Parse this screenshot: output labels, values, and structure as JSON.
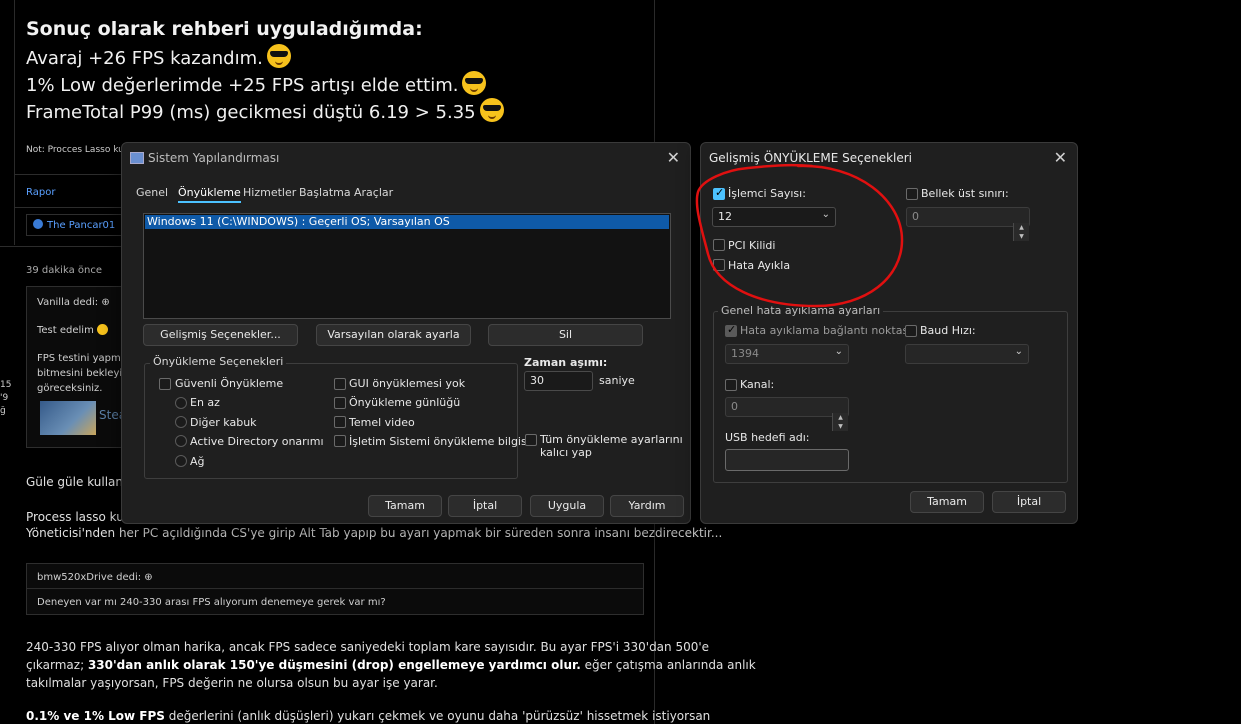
{
  "forum": {
    "heading": "Sonuç olarak rehberi uyguladığımda:",
    "lines": [
      "Avaraj +26 FPS kazandım.",
      "1% Low değerlerimde +25 FPS artışı elde ettim.",
      "FrameTotal P99 (ms) gecikmesi düştü 6.19 > 5.35"
    ],
    "note": "Not: Procces Lasso kull",
    "report_link": "Rapor",
    "reaction_user": "The Pancar01",
    "post_time": "39 dakika önce",
    "quote1_author": "Vanilla dedi:",
    "quote1_text": "Test edelim",
    "quote1_body1": "FPS testini yapmak",
    "quote1_body2": "bitmesini bekleyin.",
    "quote1_body3": "göreceksiniz.",
    "steam_label": "Stea",
    "side_nums": [
      "15",
      "'9",
      "ğ"
    ],
    "reply1": "Güle güle kullanın",
    "reply2": "Process lasso kulla",
    "reply3": "Yöneticisi'nden her PC açıldığında CS'ye girip Alt Tab yapıp bu ayarı yapmak bir süreden sonra insanı bezdirecektir...",
    "quote2_author": "bmw520xDrive dedi:",
    "quote2_text": "Deneyen var mı 240-330 arası FPS alıyorum denemeye gerek var mı?",
    "p1": "240-330 FPS alıyor olman harika, ancak FPS sadece saniyedeki toplam kare sayısıdır. Bu ayar FPS'i 330'dan 500'e",
    "p2a": "çıkarmaz; ",
    "p2b": "330'dan anlık olarak 150'ye düşmesini (drop) engellemeye yardımcı olur.",
    "p2c": " eğer çatışma anlarında anlık",
    "p3": "takılmalar yaşıyorsan, FPS değerin ne olursa olsun bu ayar işe yarar.",
    "p4a": "0.1% ve 1% Low FPS",
    "p4b": " değerlerini (anlık düşüşleri) yukarı çekmek ve oyunu daha 'pürüzsüz' hissetmek istiyorsan"
  },
  "syscfg": {
    "title": "Sistem Yapılandırması",
    "tabs": [
      "Genel",
      "Önyükleme",
      "Hizmetler",
      "Başlatma",
      "Araçlar"
    ],
    "os_entry": "Windows 11 (C:\\WINDOWS) : Geçerli OS; Varsayılan OS",
    "btn_advanced": "Gelişmiş Seçenekler...",
    "btn_default": "Varsayılan olarak ayarla",
    "btn_delete": "Sil",
    "boot_options_title": "Önyükleme Seçenekleri",
    "safe_boot": "Güvenli Önyükleme",
    "radio_min": "En az",
    "radio_alt_shell": "Diğer kabuk",
    "radio_ad": "Active Directory onarımı",
    "radio_net": "Ağ",
    "no_gui": "GUI önyüklemesi yok",
    "boot_log": "Önyükleme günlüğü",
    "base_video": "Temel video",
    "os_boot_info": "İşletim Sistemi önyükleme bilgisi",
    "timeout_label": "Zaman aşımı:",
    "timeout_value": "30",
    "timeout_unit": "saniye",
    "permanent1": "Tüm önyükleme ayarlarını",
    "permanent2": "kalıcı yap",
    "ok": "Tamam",
    "cancel": "İptal",
    "apply": "Uygula",
    "help": "Yardım"
  },
  "advboot": {
    "title": "Gelişmiş ÖNYÜKLEME Seçenekleri",
    "cpu_count_label": "İşlemci Sayısı:",
    "cpu_count_value": "12",
    "max_mem_label": "Bellek üst sınırı:",
    "max_mem_value": "0",
    "pci_lock": "PCI Kilidi",
    "debug": "Hata Ayıkla",
    "global_debug_title": "Genel hata ayıklama ayarları",
    "debug_port_label": "Hata ayıklama bağlantı noktası:",
    "debug_port_value": "1394",
    "baud_label": "Baud Hızı:",
    "baud_value": "",
    "channel_label": "Kanal:",
    "channel_value": "0",
    "usb_target_label": "USB hedefi adı:",
    "usb_target_value": "",
    "ok": "Tamam",
    "cancel": "İptal"
  },
  "colors": {
    "accent": "#4cc2ff",
    "annotation": "#e01010",
    "selection": "#0f5aa8"
  }
}
